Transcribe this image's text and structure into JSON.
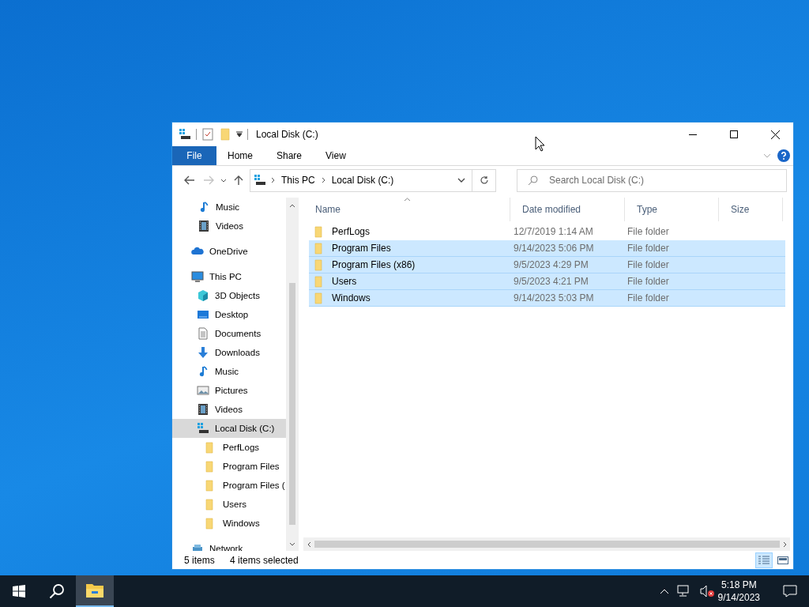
{
  "window": {
    "title": "Local Disk (C:)"
  },
  "ribbon": {
    "file_tab": "File",
    "tabs": [
      "Home",
      "Share",
      "View"
    ]
  },
  "nav_buttons": [
    {
      "kind": "back",
      "disabled": false
    },
    {
      "kind": "forward",
      "disabled": true
    },
    {
      "kind": "recent",
      "disabled": false
    },
    {
      "kind": "up",
      "disabled": false
    }
  ],
  "address": {
    "breadcrumbs": [
      "This PC",
      "Local Disk (C:)"
    ]
  },
  "search": {
    "placeholder": "Search Local Disk (C:)"
  },
  "navigation": {
    "partial_group_children": [
      {
        "label": "Music",
        "kind": "music",
        "selected": false
      },
      {
        "label": "Videos",
        "kind": "video",
        "selected": false
      }
    ],
    "items": [
      {
        "label": "OneDrive",
        "kind": "cloud",
        "selected": false
      },
      {
        "label": "This PC",
        "kind": "pc",
        "selected": false,
        "children": [
          {
            "label": "3D Objects",
            "kind": "cube",
            "selected": false
          },
          {
            "label": "Desktop",
            "kind": "desktop",
            "selected": false
          },
          {
            "label": "Documents",
            "kind": "document",
            "selected": false
          },
          {
            "label": "Downloads",
            "kind": "download",
            "selected": false
          },
          {
            "label": "Music",
            "kind": "music",
            "selected": false
          },
          {
            "label": "Pictures",
            "kind": "pictures",
            "selected": false
          },
          {
            "label": "Videos",
            "kind": "video",
            "selected": false
          },
          {
            "label": "Local Disk (C:)",
            "kind": "drive",
            "selected": true,
            "children": [
              {
                "label": "PerfLogs",
                "kind": "folder",
                "selected": false
              },
              {
                "label": "Program Files",
                "kind": "folder",
                "selected": false
              },
              {
                "label": "Program Files (",
                "kind": "folder",
                "selected": false
              },
              {
                "label": "Users",
                "kind": "folder",
                "selected": false
              },
              {
                "label": "Windows",
                "kind": "folder",
                "selected": false
              }
            ]
          }
        ]
      },
      {
        "label": "Network",
        "kind": "network",
        "selected": false
      }
    ]
  },
  "table": {
    "columns": [
      {
        "label": "Name",
        "sorted": true
      },
      {
        "label": "Date modified",
        "sorted": false
      },
      {
        "label": "Type",
        "sorted": false
      },
      {
        "label": "Size",
        "sorted": false
      }
    ],
    "rows": [
      {
        "name": "PerfLogs",
        "date": "12/7/2019 1:14 AM",
        "type": "File folder",
        "selected": false
      },
      {
        "name": "Program Files",
        "date": "9/14/2023 5:06 PM",
        "type": "File folder",
        "selected": true
      },
      {
        "name": "Program Files (x86)",
        "date": "9/5/2023 4:29 PM",
        "type": "File folder",
        "selected": true
      },
      {
        "name": "Users",
        "date": "9/5/2023 4:21 PM",
        "type": "File folder",
        "selected": true
      },
      {
        "name": "Windows",
        "date": "9/14/2023 5:03 PM",
        "type": "File folder",
        "selected": true
      }
    ]
  },
  "status_bar": {
    "item_count": "5 items",
    "selection": "4 items selected",
    "views": [
      {
        "kind": "details",
        "selected": true
      },
      {
        "kind": "large_icons",
        "selected": false
      }
    ]
  },
  "taskbar": {
    "apps": [
      {
        "kind": "explorer",
        "selected": true
      }
    ],
    "time": "5:18 PM",
    "date": "9/14/2023"
  }
}
